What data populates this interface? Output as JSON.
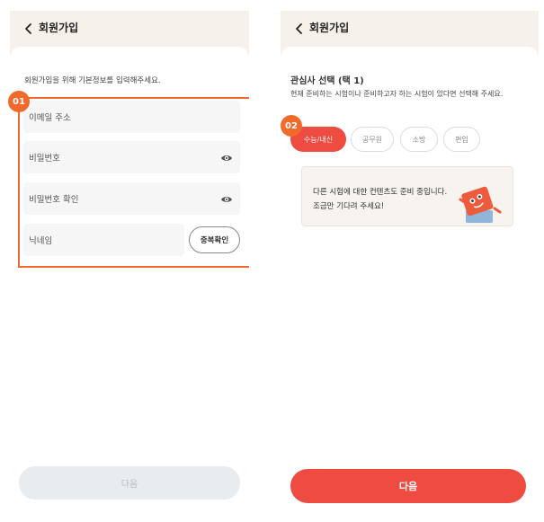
{
  "left_screen": {
    "title": "회원가입",
    "intro": "회원가입을 위해 기본정보를 입력해주세요.",
    "step_badge": "01",
    "fields": {
      "email_placeholder": "이메일 주소",
      "password_placeholder": "비밀번호",
      "password_confirm_placeholder": "비밀번호 확인",
      "nickname_placeholder": "닉네임"
    },
    "duplicate_check_label": "중복확인",
    "next_label": "다음"
  },
  "right_screen": {
    "title": "회원가입",
    "section_title": "관심사 선택 (택 1)",
    "section_desc": "현재 준비하는 시험이나 준비하고자 하는 시험이 있다면 선택해 주세요.",
    "step_badge": "02",
    "chips": [
      "수능/내신",
      "공무원",
      "소방",
      "편입"
    ],
    "selected_chip": "수능/내신",
    "notice_line1": "다른 시험에 대한 컨텐츠도 준비 중입니다.",
    "notice_line2": "조금만 기다려 주세요!",
    "next_label": "다음"
  },
  "colors": {
    "highlight": "#ef6a2b",
    "accent": "#ee4b41",
    "header_bg": "#f6f1ea",
    "field_bg": "#f6f6f6",
    "disabled_button": "#e9ecee"
  },
  "icons": [
    "back-arrow-icon",
    "eye-icon",
    "mascot-illustration"
  ]
}
